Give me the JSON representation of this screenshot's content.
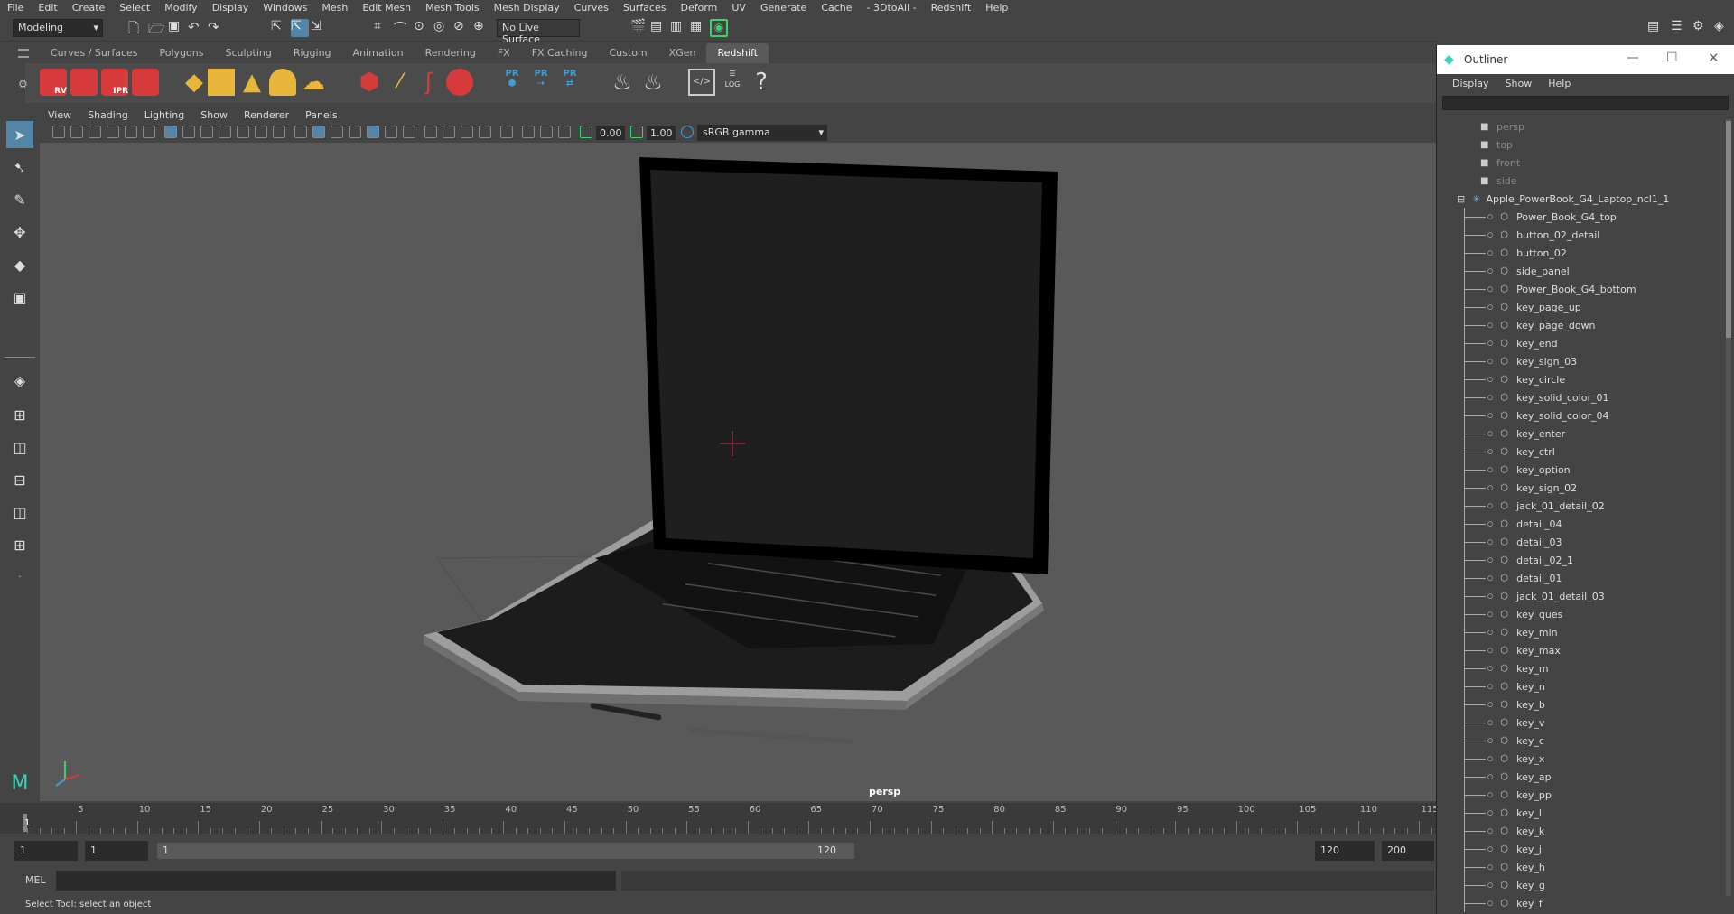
{
  "menus": [
    "File",
    "Edit",
    "Create",
    "Select",
    "Modify",
    "Display",
    "Windows",
    "Mesh",
    "Edit Mesh",
    "Mesh Tools",
    "Mesh Display",
    "Curves",
    "Surfaces",
    "Deform",
    "UV",
    "Generate",
    "Cache",
    "- 3DtoAll -",
    "Redshift",
    "Help"
  ],
  "workspace": "Modeling",
  "live_surface": "No Live Surface",
  "shelf_tabs": [
    "Curves / Surfaces",
    "Polygons",
    "Sculpting",
    "Rigging",
    "Animation",
    "Rendering",
    "FX",
    "FX Caching",
    "Custom",
    "XGen",
    "Redshift"
  ],
  "active_shelf": "Redshift",
  "shelf_labels": {
    "rv": "RV",
    "ipr": "IPR",
    "pr": "PR",
    "log": "LOG"
  },
  "panel_menus": [
    "View",
    "Shading",
    "Lighting",
    "Show",
    "Renderer",
    "Panels"
  ],
  "exposure": "0.00",
  "gamma": "1.00",
  "color_space": "sRGB gamma",
  "camera_label": "persp",
  "timeline_ticks": [
    "5",
    "10",
    "15",
    "20",
    "25",
    "30",
    "35",
    "40",
    "45",
    "50",
    "55",
    "60",
    "65",
    "70",
    "75",
    "80",
    "85",
    "90",
    "95",
    "100",
    "105",
    "110",
    "115"
  ],
  "current_frame": "1",
  "range": {
    "start": "1",
    "anim_start": "1",
    "slider_start": "1",
    "slider_end": "120",
    "end": "120",
    "anim_end": "200"
  },
  "cmd_label": "MEL",
  "help_text": "Select Tool: select an object",
  "outliner": {
    "title": "Outliner",
    "menus": [
      "Display",
      "Show",
      "Help"
    ],
    "cameras": [
      "persp",
      "top",
      "front",
      "side"
    ],
    "root": "Apple_PowerBook_G4_Laptop_ncl1_1",
    "children": [
      "Power_Book_G4_top",
      "button_02_detail",
      "button_02",
      "side_panel",
      "Power_Book_G4_bottom",
      "key_page_up",
      "key_page_down",
      "key_end",
      "key_sign_03",
      "key_circle",
      "key_solid_color_01",
      "key_solid_color_04",
      "key_enter",
      "key_ctrl",
      "key_option",
      "key_sign_02",
      "jack_01_detail_02",
      "detail_04",
      "detail_03",
      "detail_02_1",
      "detail_01",
      "jack_01_detail_03",
      "key_ques",
      "key_min",
      "key_max",
      "key_m",
      "key_n",
      "key_b",
      "key_v",
      "key_c",
      "key_x",
      "key_ap",
      "key_pp",
      "key_l",
      "key_k",
      "key_j",
      "key_h",
      "key_g",
      "key_f"
    ]
  },
  "colors": {
    "accent": "#5285a6",
    "shelf_red": "#d63a3a",
    "shelf_yellow": "#e8b63a",
    "pr_blue": "#3aa0d8"
  }
}
